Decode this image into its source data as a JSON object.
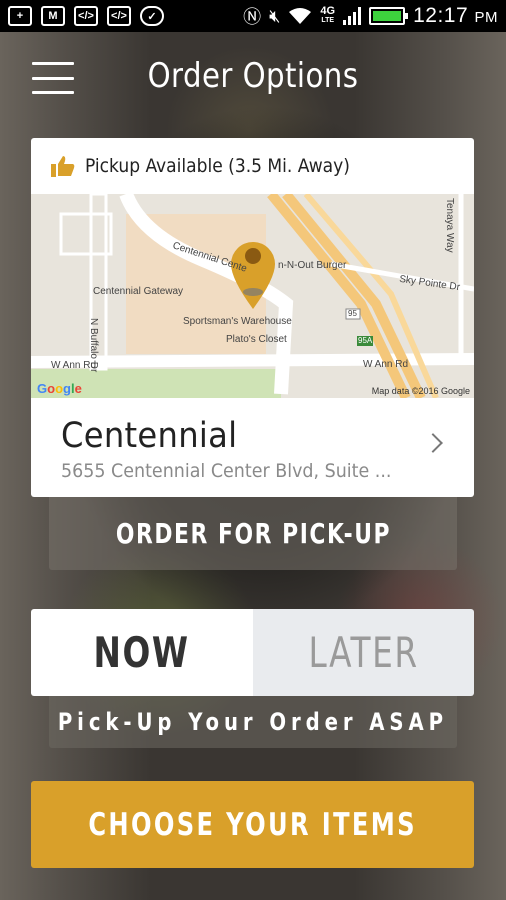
{
  "status_bar": {
    "time": "12:17",
    "ampm": "PM",
    "network": "4G",
    "network_sub": "LTE",
    "battery_color": "#3dd13d",
    "icons": [
      "add-icon",
      "gmail-icon",
      "code-icon",
      "code-icon",
      "chat-icon",
      "nfc-icon",
      "mute-icon",
      "wifi-icon",
      "signal-icon",
      "battery-icon"
    ]
  },
  "header": {
    "title": "Order Options",
    "menu_icon": "hamburger-menu-icon"
  },
  "location_card": {
    "pickup_status": "Pickup Available (3.5 Mi. Away)",
    "map": {
      "labels": {
        "centennial_center": "Centennial Cente",
        "in_n_out": "n-N-Out Burger",
        "centennial_gateway": "Centennial Gateway",
        "sportsmans": "Sportsman's Warehouse",
        "platos": "Plato's Closet",
        "sky_pointe": "Sky Pointe Dr",
        "buffalo": "N Buffalo Dr",
        "w_ann_rd_left": "W Ann Rd",
        "w_ann_rd_right": "W Ann Rd",
        "tenaya": "Tenaya Way",
        "hwy_95": "95",
        "hwy_95a": "95A"
      },
      "google_logo": "Google",
      "attribution": "Map data ©2016 Google"
    },
    "store_name": "Centennial",
    "store_address": "5655 Centennial Center Blvd, Suite ..."
  },
  "order_mode_label": "ORDER FOR PICK-UP",
  "timing": {
    "now_label": "NOW",
    "later_label": "LATER",
    "selected": "now"
  },
  "timing_subtitle": "Pick-Up Your Order ASAP",
  "cta_label": "CHOOSE YOUR ITEMS",
  "colors": {
    "accent": "#d9a02a",
    "pin": "#d9a02a"
  }
}
